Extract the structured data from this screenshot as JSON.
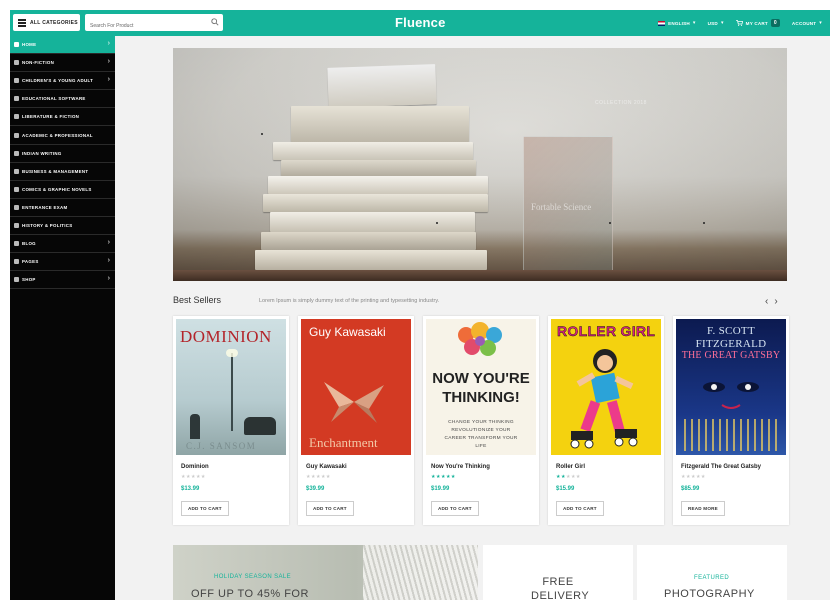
{
  "header": {
    "all_categories": "ALL CATEGORIES",
    "search_placeholder": "Search For Product",
    "brand": "Fluence",
    "language": "ENGLISH",
    "currency": "USD",
    "cart_label": "MY CART",
    "cart_count": "0",
    "account": "ACCOUNT"
  },
  "sidebar": {
    "items": [
      {
        "label": "HOME",
        "arrow": "›"
      },
      {
        "label": "NON-FICTION",
        "arrow": "›"
      },
      {
        "label": "CHILDREN'S & YOUNG ADULT",
        "arrow": "›"
      },
      {
        "label": "EDUCATIONAL SOFTWARE",
        "arrow": ""
      },
      {
        "label": "LIBERATURE & FICTION",
        "arrow": ""
      },
      {
        "label": "ACADEMIC & PROFESSIONAL",
        "arrow": ""
      },
      {
        "label": "INDIAN WRITING",
        "arrow": ""
      },
      {
        "label": "BUSINESS & MANAGEMENT",
        "arrow": ""
      },
      {
        "label": "COMICS & GRAPHIC NOVELS",
        "arrow": ""
      },
      {
        "label": "ENTERANCE EXAM",
        "arrow": ""
      },
      {
        "label": "HISTORY & POLITICS",
        "arrow": ""
      },
      {
        "label": "BLOG",
        "arrow": "›"
      },
      {
        "label": "PAGES",
        "arrow": "›"
      },
      {
        "label": "SHOP",
        "arrow": "›"
      }
    ]
  },
  "hero": {
    "collection": "COLLECTION 2018",
    "sign_title": "Fortable Science"
  },
  "best_sellers": {
    "title": "Best Sellers",
    "subtitle": "Lorem Ipsum is simply dummy text of the printing and typesetting industry.",
    "prev": "‹",
    "next": "›"
  },
  "products": [
    {
      "name": "Dominion",
      "price": "$13.99",
      "rating": 0,
      "button": "ADD TO CART",
      "cover_title": "DOMINION",
      "cover_author": "C.J. SANSOM"
    },
    {
      "name": "Guy Kawasaki",
      "price": "$39.99",
      "rating": 0,
      "button": "ADD TO CART",
      "cover_title": "Guy Kawasaki",
      "cover_author": "Enchantment"
    },
    {
      "name": "Now You're Thinking",
      "price": "$19.99",
      "rating": 5,
      "button": "ADD TO CART",
      "cover_title": "NOW YOU'RE THINKING!",
      "cover_author": "CHANGE YOUR THINKING REVOLUTIONIZE YOUR CAREER TRANSFORM YOUR LIFE"
    },
    {
      "name": "Roller Girl",
      "price": "$15.99",
      "rating": 2,
      "button": "ADD TO CART",
      "cover_title": "ROLLER GIRL",
      "cover_author": ""
    },
    {
      "name": "Fitzgerald The Great Gatsby",
      "price": "$85.99",
      "rating": 0,
      "button": "READ MORE",
      "cover_title": "F. SCOTT FITZGERALD",
      "cover_author": "THE GREAT GATSBY"
    }
  ],
  "promos": {
    "holiday_small": "HOLIDAY SEASON SALE",
    "holiday_big": "OFF UP TO 45% FOR",
    "delivery_big": "FREE DELIVERY",
    "featured_small": "FEATURED",
    "featured_big": "PHOTOGRAPHY"
  },
  "colors": {
    "accent": "#15b39a",
    "sidebar_bg": "#060606"
  },
  "icons": [
    "menu-icon",
    "search-icon",
    "flag-icon",
    "cart-icon",
    "chevron-left-icon",
    "chevron-right-icon"
  ]
}
